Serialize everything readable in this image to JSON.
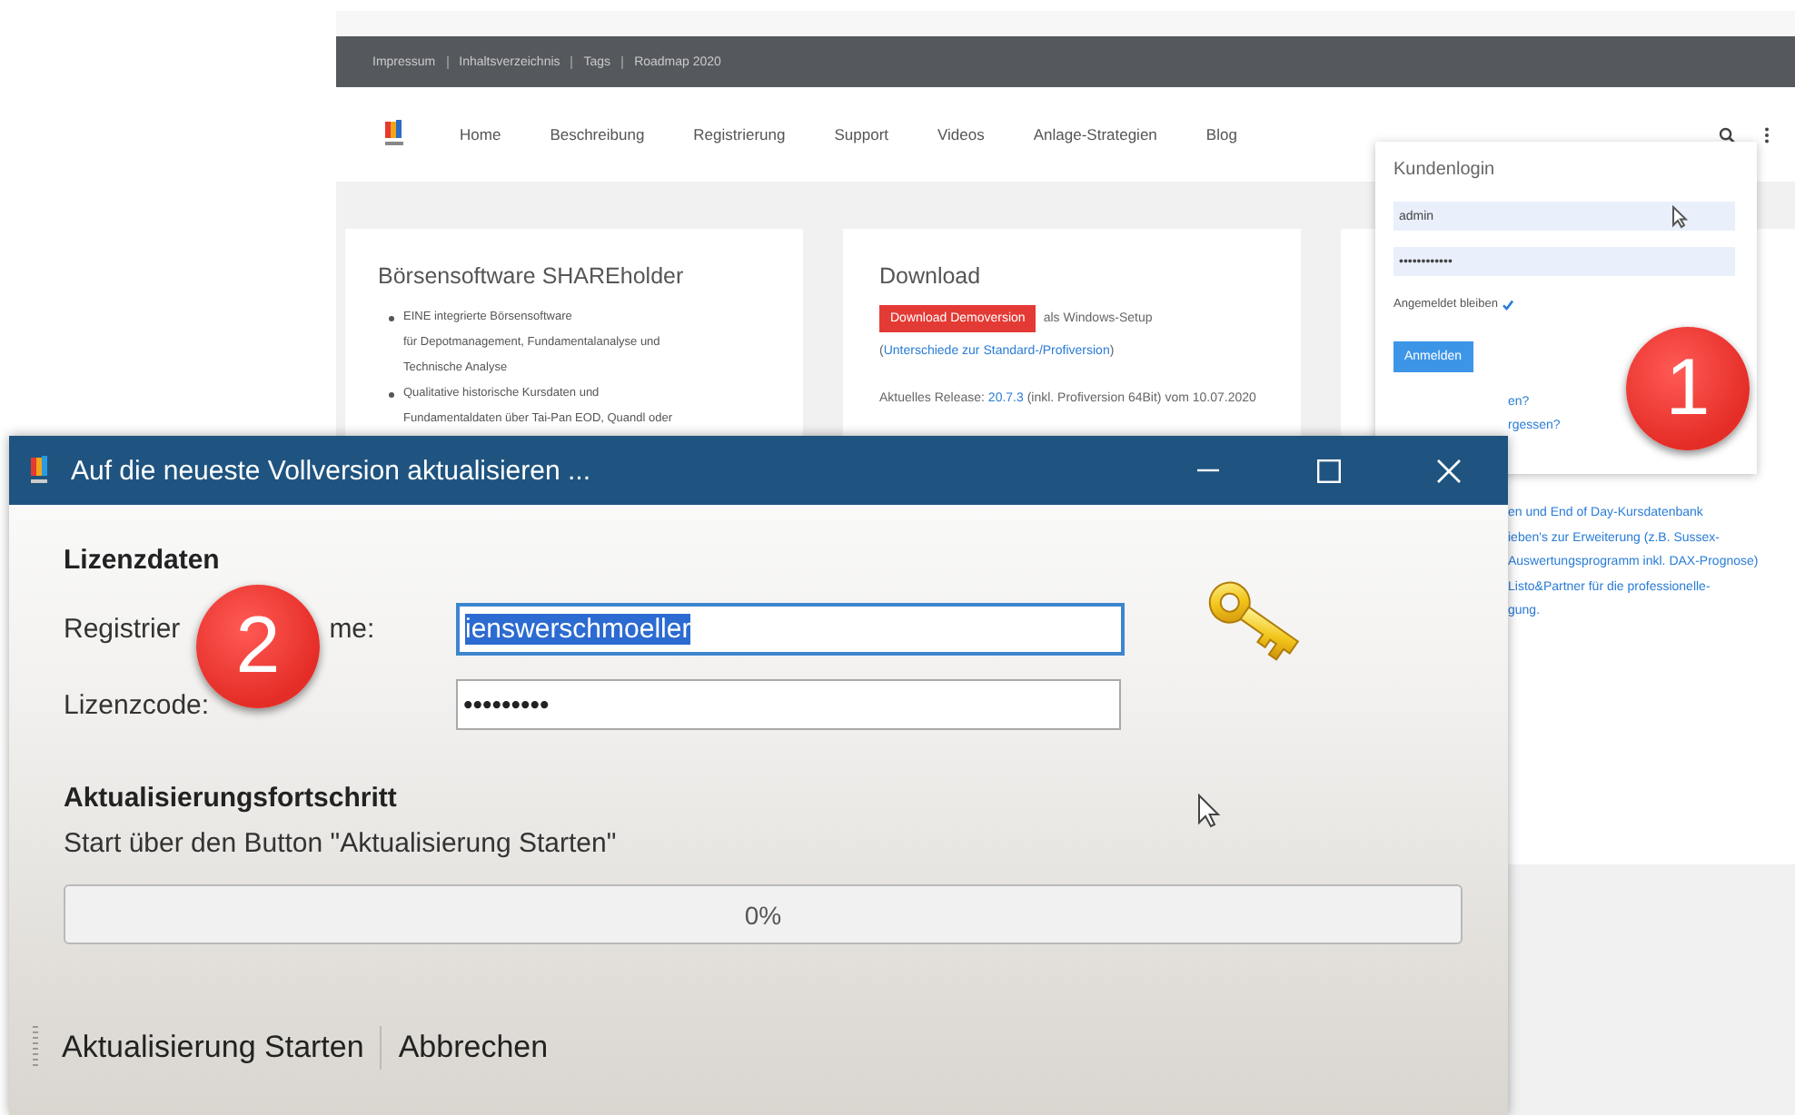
{
  "website": {
    "breadcrumbs": [
      "Impressum",
      "Inhaltsverzeichnis",
      "Tags",
      "Roadmap 2020"
    ],
    "nav": [
      "Home",
      "Beschreibung",
      "Registrierung",
      "Support",
      "Videos",
      "Anlage-Strategien",
      "Blog"
    ],
    "cards": [
      {
        "kind": "features",
        "title": "Börsensoftware SHAREholder",
        "bullets": [
          [
            "EINE integrierte Börsensoftware",
            "für Depotmanagement, Fundamentalanalyse und",
            "Technische Analyse"
          ],
          [
            "Qualitative historische Kursdaten und",
            "Fundamentaldaten über Tai-Pan EOD, Quandl oder"
          ]
        ]
      },
      {
        "kind": "download",
        "title": "Download",
        "button": "Download Demoversion",
        "button_note": "als Windows-Setup",
        "link_open": "(",
        "link": "Unterschiede zur Standard-/Profiversion",
        "link_close": ")",
        "release_label": "Aktuelles Release:",
        "release_version": "20.7.3",
        "release_note": "(inkl. Profiversion 64Bit) vom 10.07.2020"
      },
      {
        "kind": "fragments",
        "lines": [
          "en und End of Day-Kursdatenbank",
          "ieben's zur Erweiterung (z.B. Sussex-",
          "Auswertungsprogramm inkl. DAX-Prognose)",
          "Listo&Partner für die professionelle-",
          "gung."
        ]
      }
    ],
    "login": {
      "title": "Kundenlogin",
      "username": "admin",
      "password": "••••••••••••",
      "remember": {
        "label": "Angemeldet bleiben",
        "checked": true
      },
      "button": "Anmelden",
      "links": [
        "en?",
        "rgessen?"
      ]
    }
  },
  "dialog": {
    "title": "Auf die neueste Vollversion aktualisieren ...",
    "section_1": "Lizenzdaten",
    "fields": [
      {
        "label_parts": [
          "Registrier",
          "me:"
        ],
        "value": "ienswerschmoeller",
        "selected": true
      },
      {
        "label_parts": [
          "Lizenzcode:"
        ],
        "value": "•••••••••",
        "selected": false
      }
    ],
    "section_2": "Aktualisierungsfortschritt",
    "hint": "Start über den Button \"Aktualisierung Starten\"",
    "progress": {
      "level": 0,
      "reading": "0%"
    },
    "buttons": [
      "Aktualisierung Starten",
      "Abbrechen"
    ]
  },
  "badges": [
    {
      "label": "1"
    },
    {
      "label": "2"
    }
  ]
}
